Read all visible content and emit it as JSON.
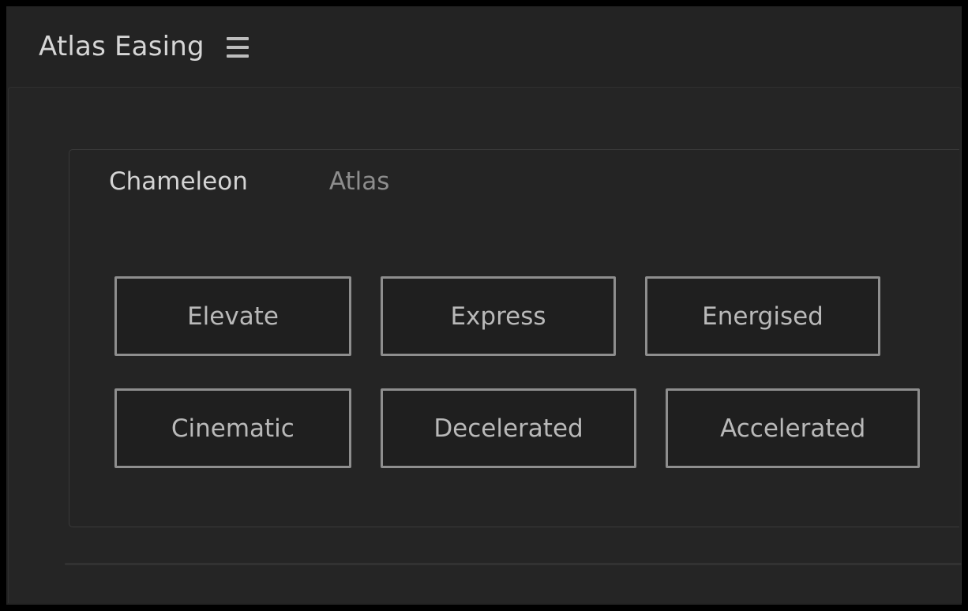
{
  "window": {
    "background_color": "#232323",
    "frame_color": "#000000"
  },
  "header": {
    "title": "Atlas Easing",
    "menu_icon": "hamburger-menu-icon",
    "title_color": "#d6d6d6"
  },
  "panel": {
    "tabs": [
      {
        "label": "Chameleon",
        "active": true
      },
      {
        "label": "Atlas",
        "active": false
      }
    ],
    "active_tab_color": "#d4d4d4",
    "inactive_tab_color": "#8d8d8d",
    "underline_color": "#b9b9b9",
    "button_rows": [
      {
        "buttons": [
          {
            "label": "Elevate"
          },
          {
            "label": "Express"
          },
          {
            "label": "Energised"
          }
        ]
      },
      {
        "buttons": [
          {
            "label": "Cinematic"
          },
          {
            "label": "Decelerated"
          },
          {
            "label": "Accelerated"
          }
        ]
      }
    ],
    "button_border_color": "#8e8e8e",
    "button_text_color": "#b9b9b9",
    "button_fill_color": "#1f1f1f"
  }
}
